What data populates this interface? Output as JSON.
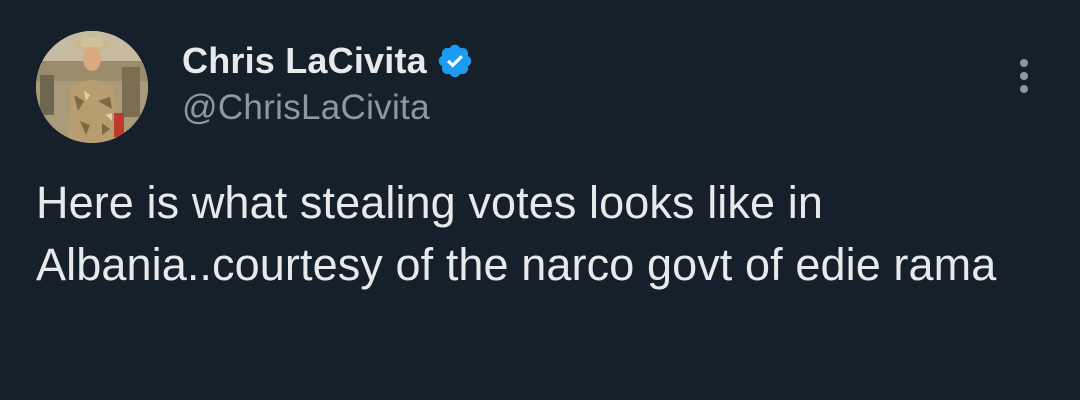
{
  "author": {
    "display_name": "Chris LaCivita",
    "handle": "@ChrisLaCivita",
    "verified": true,
    "verified_badge_color": "#1d9bf0"
  },
  "avatar": {
    "icon": "user-avatar-photo"
  },
  "tweet": {
    "text": "Here is what stealing votes looks like in Albania..courtesy of the narco govt of edie rama"
  },
  "menu": {
    "icon": "more-vertical-icon"
  },
  "colors": {
    "background": "#15202b",
    "primary_text": "#e7e9ea",
    "secondary_text": "#8b98a5"
  }
}
